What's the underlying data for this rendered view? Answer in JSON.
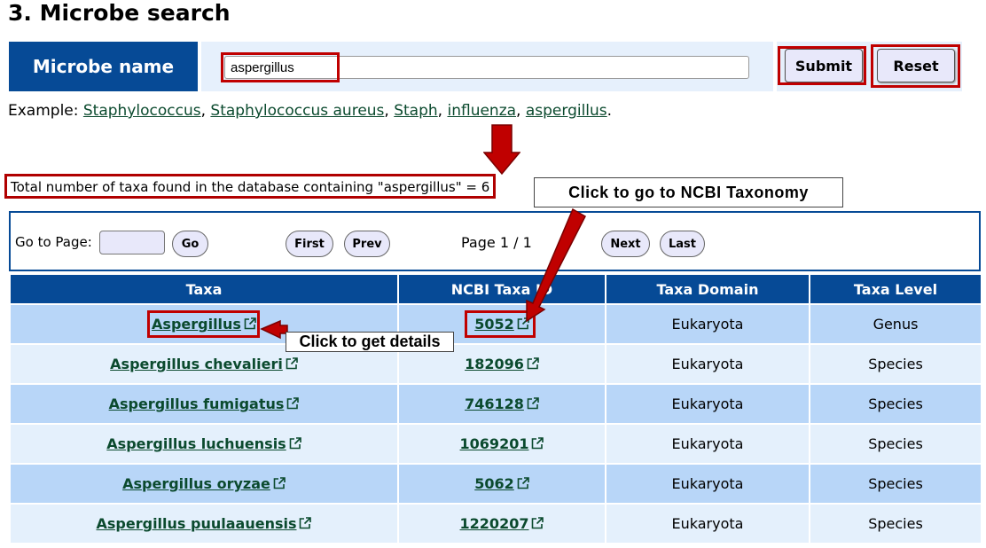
{
  "page_title": "3. Microbe search",
  "search": {
    "label": "Microbe name",
    "value": "aspergillus",
    "submit_label": "Submit",
    "reset_label": "Reset"
  },
  "examples": {
    "prefix": "Example: ",
    "links": [
      "Staphylococcus",
      "Staphylococcus aureus",
      "Staph",
      "influenza",
      "aspergillus"
    ],
    "separator": ", ",
    "suffix": "."
  },
  "result_summary": "Total number of taxa found in the database containing \"aspergillus\" = 6",
  "annotations": {
    "ncbi_callout": "Click to go to NCBI Taxonomy",
    "details_callout": "Click to get details"
  },
  "pager": {
    "goto_label": "Go to Page:",
    "go_label": "Go",
    "first_label": "First",
    "prev_label": "Prev",
    "page_info": "Page 1 / 1",
    "next_label": "Next",
    "last_label": "Last"
  },
  "table": {
    "headers": [
      "Taxa",
      "NCBI Taxa ID",
      "Taxa Domain",
      "Taxa Level"
    ],
    "rows": [
      {
        "taxa": "Aspergillus",
        "ncbi_id": "5052",
        "domain": "Eukaryota",
        "level": "Genus"
      },
      {
        "taxa": "Aspergillus chevalieri",
        "ncbi_id": "182096",
        "domain": "Eukaryota",
        "level": "Species"
      },
      {
        "taxa": "Aspergillus fumigatus",
        "ncbi_id": "746128",
        "domain": "Eukaryota",
        "level": "Species"
      },
      {
        "taxa": "Aspergillus luchuensis",
        "ncbi_id": "1069201",
        "domain": "Eukaryota",
        "level": "Species"
      },
      {
        "taxa": "Aspergillus oryzae",
        "ncbi_id": "5062",
        "domain": "Eukaryota",
        "level": "Species"
      },
      {
        "taxa": "Aspergillus puulaauensis",
        "ncbi_id": "1220207",
        "domain": "Eukaryota",
        "level": "Species"
      }
    ]
  },
  "colors": {
    "header_blue": "#064a96",
    "row_odd": "#b8d6f8",
    "row_even": "#e4f0fc",
    "highlight_red": "#c00000",
    "link_green": "#0b4a2e"
  }
}
